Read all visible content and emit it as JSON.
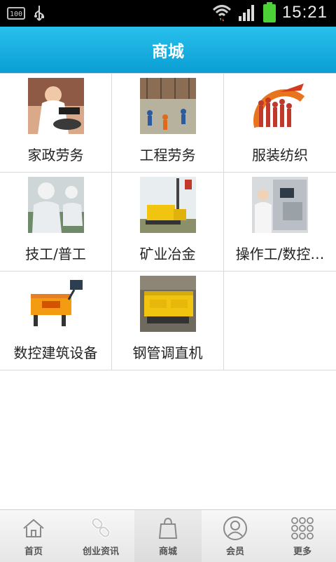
{
  "status_bar": {
    "battery_small_text": "100",
    "time": "15:21",
    "icons": [
      "battery-100-icon",
      "usb-icon",
      "wifi-icon",
      "signal-icon",
      "battery-icon"
    ]
  },
  "header": {
    "title": "商城"
  },
  "grid": {
    "items": [
      {
        "label": "家政劳务",
        "image": "domestic-service-photo"
      },
      {
        "label": "工程劳务",
        "image": "construction-labor-photo"
      },
      {
        "label": "服装纺织",
        "image": "textile-photo"
      },
      {
        "label": "技工/普工",
        "image": "technician-photo"
      },
      {
        "label": "矿业冶金",
        "image": "mining-photo"
      },
      {
        "label": "操作工/数控…",
        "image": "cnc-operator-photo"
      },
      {
        "label": "数控建筑设备",
        "image": "cnc-equipment-photo"
      },
      {
        "label": "钢管调直机",
        "image": "pipe-straightener-photo"
      }
    ]
  },
  "tabbar": {
    "tabs": [
      {
        "label": "首页",
        "icon": "home-icon"
      },
      {
        "label": "创业资讯",
        "icon": "link-icon"
      },
      {
        "label": "商城",
        "icon": "shopping-bag-icon"
      },
      {
        "label": "会员",
        "icon": "user-icon"
      },
      {
        "label": "更多",
        "icon": "more-grid-icon"
      }
    ]
  },
  "colors": {
    "header_top": "#29c0ec",
    "header_bottom": "#0a9ed3",
    "battery_green": "#4cd137"
  }
}
